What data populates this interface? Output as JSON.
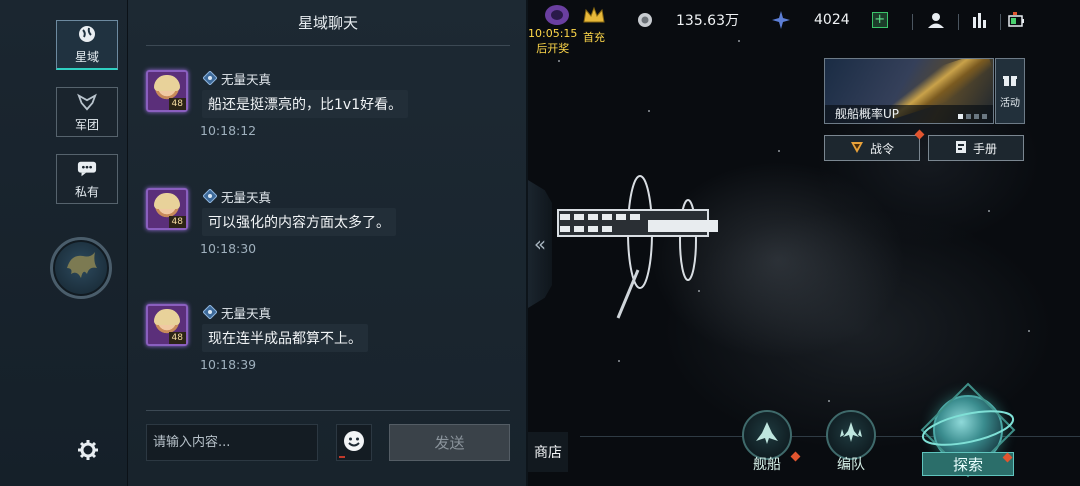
{
  "rail": {
    "tabs": [
      {
        "label": "星域",
        "icon": "globe-icon"
      },
      {
        "label": "军团",
        "icon": "legion-emblem-icon"
      },
      {
        "label": "私有",
        "icon": "private-chat-icon"
      }
    ],
    "orb_icon": "faction-emblem-icon",
    "settings_icon": "gear-icon"
  },
  "chat": {
    "title": "星域聊天",
    "messages": [
      {
        "sender": "无量天真",
        "level": "48",
        "text": "船还是挺漂亮的，比1v1好看。",
        "time": "10:18:12"
      },
      {
        "sender": "无量天真",
        "level": "48",
        "text": "可以强化的内容方面太多了。",
        "time": "10:18:30"
      },
      {
        "sender": "无量天真",
        "level": "48",
        "text": "现在连半成品都算不上。",
        "time": "10:18:39"
      }
    ],
    "input_placeholder": "请输入内容...",
    "send_label": "发送",
    "emoji_icon": "smiley-icon"
  },
  "collapse_label": "«",
  "hud": {
    "timer": "10:05:15",
    "timer_caption": "后开奖",
    "first_charge": "首充",
    "currency_amount": "135.63万",
    "energy_amount": "4024",
    "plus_label": "+"
  },
  "event": {
    "banner_caption": "舰船概率UP",
    "activity_label": "活动",
    "battle_pass_label": "战令",
    "handbook_label": "手册"
  },
  "bottom_nav": {
    "shop_label": "商店",
    "ships_label": "舰船",
    "fleet_label": "编队",
    "explore_label": "探索"
  },
  "colors": {
    "accent_teal": "#2fd0c2",
    "alert_red": "#e2552f",
    "gold": "#ffd84a"
  }
}
